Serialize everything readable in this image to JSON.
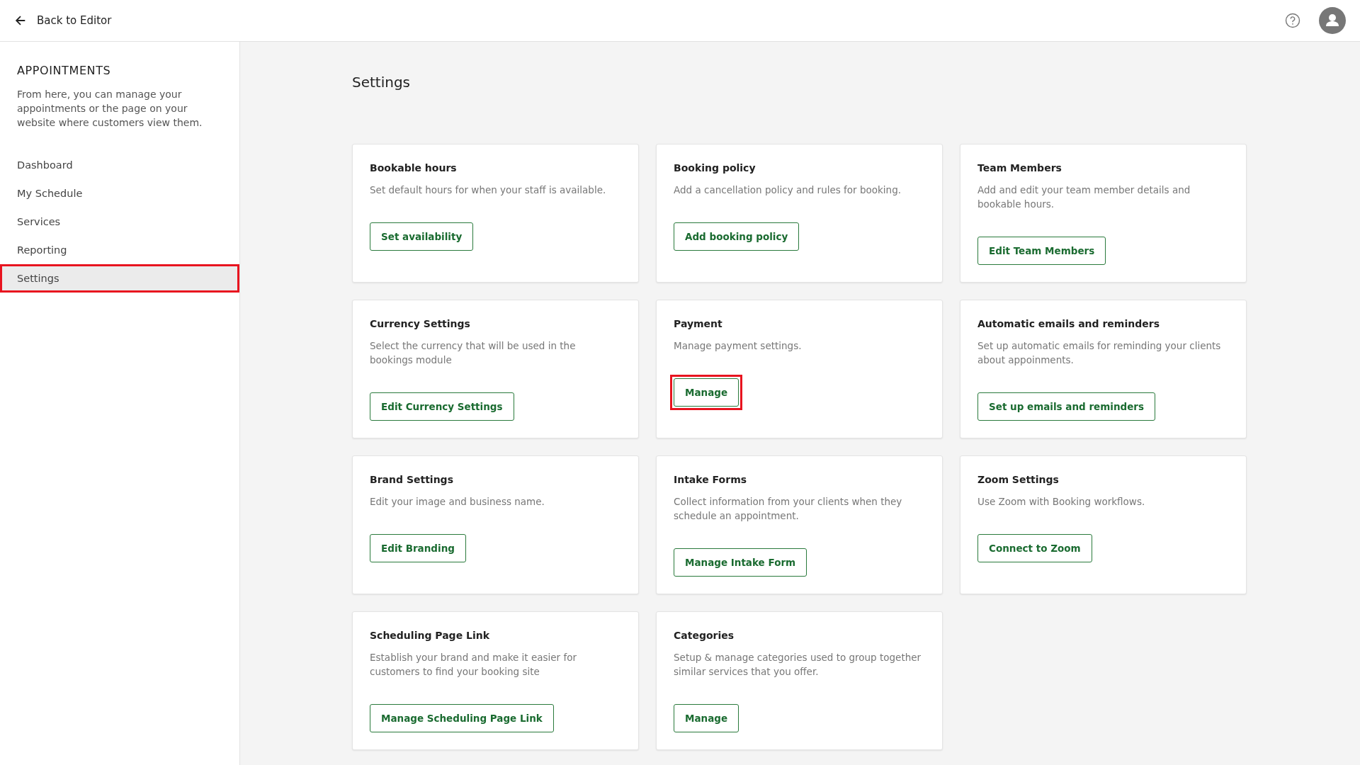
{
  "header": {
    "back_link": "Back to Editor"
  },
  "sidebar": {
    "title": "APPOINTMENTS",
    "description": "From here, you can manage your appointments or the page on your website where customers view them.",
    "items": [
      {
        "label": "Dashboard",
        "selected": false,
        "highlighted": false
      },
      {
        "label": "My Schedule",
        "selected": false,
        "highlighted": false
      },
      {
        "label": "Services",
        "selected": false,
        "highlighted": false
      },
      {
        "label": "Reporting",
        "selected": false,
        "highlighted": false
      },
      {
        "label": "Settings",
        "selected": true,
        "highlighted": true
      }
    ]
  },
  "page": {
    "title": "Settings"
  },
  "cards": [
    {
      "title": "Bookable hours",
      "description": "Set default hours for when your staff is available.",
      "button": "Set availability",
      "highlighted": false
    },
    {
      "title": "Booking policy",
      "description": "Add a cancellation policy and rules for booking.",
      "button": "Add booking policy",
      "highlighted": false
    },
    {
      "title": "Team Members",
      "description": "Add and edit your team member details and bookable hours.",
      "button": "Edit Team Members",
      "highlighted": false
    },
    {
      "title": "Currency Settings",
      "description": "Select the currency that will be used in the bookings module",
      "button": "Edit Currency Settings",
      "highlighted": false
    },
    {
      "title": "Payment",
      "description": "Manage payment settings.",
      "button": "Manage",
      "highlighted": true
    },
    {
      "title": "Automatic emails and reminders",
      "description": "Set up automatic emails for reminding your clients about appoinments.",
      "button": "Set up emails and reminders",
      "highlighted": false
    },
    {
      "title": "Brand Settings",
      "description": "Edit your image and business name.",
      "button": "Edit Branding",
      "highlighted": false
    },
    {
      "title": "Intake Forms",
      "description": "Collect information from your clients when they schedule an appointment.",
      "button": "Manage Intake Form",
      "highlighted": false
    },
    {
      "title": "Zoom Settings",
      "description": "Use Zoom with Booking workflows.",
      "button": "Connect to Zoom",
      "highlighted": false
    },
    {
      "title": "Scheduling Page Link",
      "description": "Establish your brand and make it easier for customers to find your booking site",
      "button": "Manage Scheduling Page Link",
      "highlighted": false
    },
    {
      "title": "Categories",
      "description": "Setup & manage categories used to group together similar services that you offer.",
      "button": "Manage",
      "highlighted": false
    }
  ]
}
